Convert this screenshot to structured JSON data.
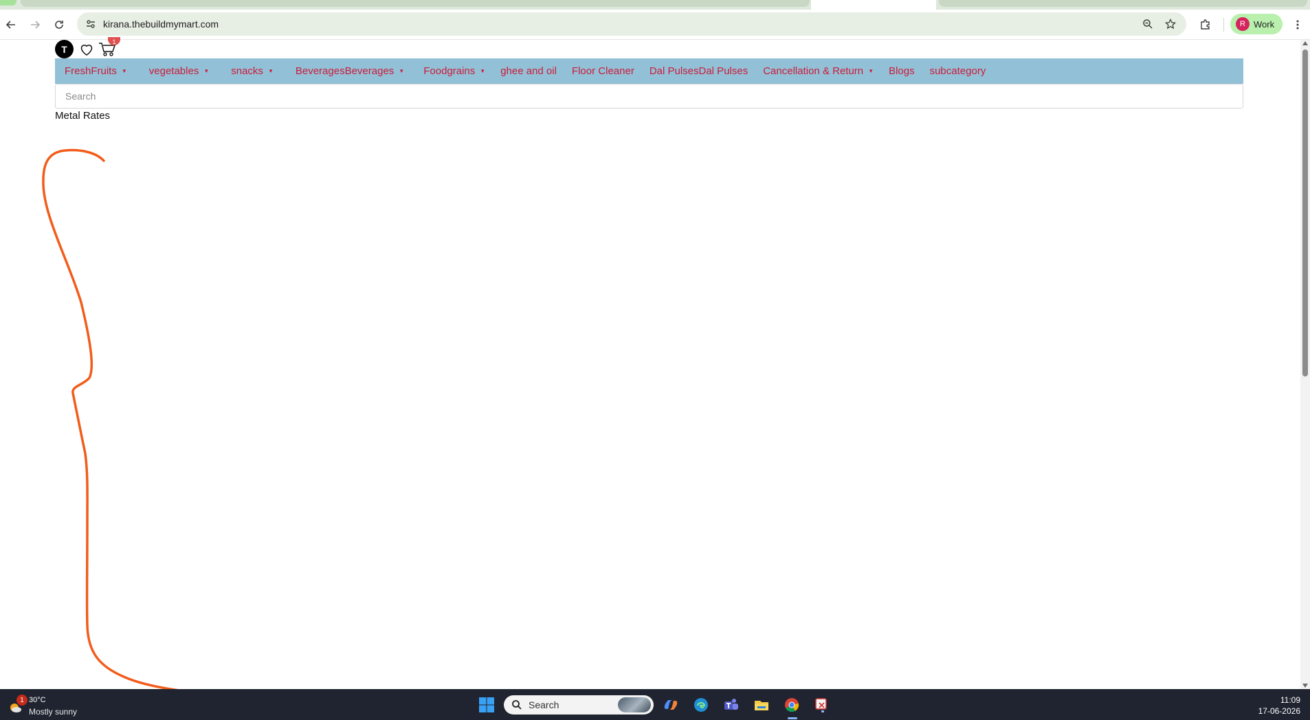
{
  "browser": {
    "url": "kirana.thebuildmymart.com",
    "profile_initial": "R",
    "profile_label": "Work",
    "colors": {
      "profile_bg": "#b9f0ad",
      "profile_avatar": "#d4245e"
    }
  },
  "site": {
    "user_initial": "T",
    "cart_count": "1",
    "menu": [
      {
        "label": "FreshFruits",
        "has_dropdown": true
      },
      {
        "label": "vegetables",
        "has_dropdown": true
      },
      {
        "label": "snacks",
        "has_dropdown": true
      },
      {
        "label": "BeveragesBeverages",
        "has_dropdown": true
      },
      {
        "label": "Foodgrains",
        "has_dropdown": true
      },
      {
        "label": "ghee and oil",
        "has_dropdown": false
      },
      {
        "label": "Floor Cleaner",
        "has_dropdown": false
      },
      {
        "label": "Dal PulsesDal Pulses",
        "has_dropdown": false
      },
      {
        "label": "Cancellation & Return",
        "has_dropdown": true
      },
      {
        "label": "Blogs",
        "has_dropdown": false
      },
      {
        "label": "subcategory",
        "has_dropdown": false
      }
    ],
    "search_placeholder": "Search",
    "section_label": "Metal Rates",
    "colors": {
      "menu_bg": "#92c1d7",
      "menu_text": "#cc1b3a",
      "annotation_stroke": "#f25c1b"
    }
  },
  "taskbar": {
    "weather_badge": "1",
    "temperature": "30°C",
    "condition": "Mostly sunny",
    "search_label": "Search",
    "time": "11:09",
    "date": "17-06-2026"
  }
}
